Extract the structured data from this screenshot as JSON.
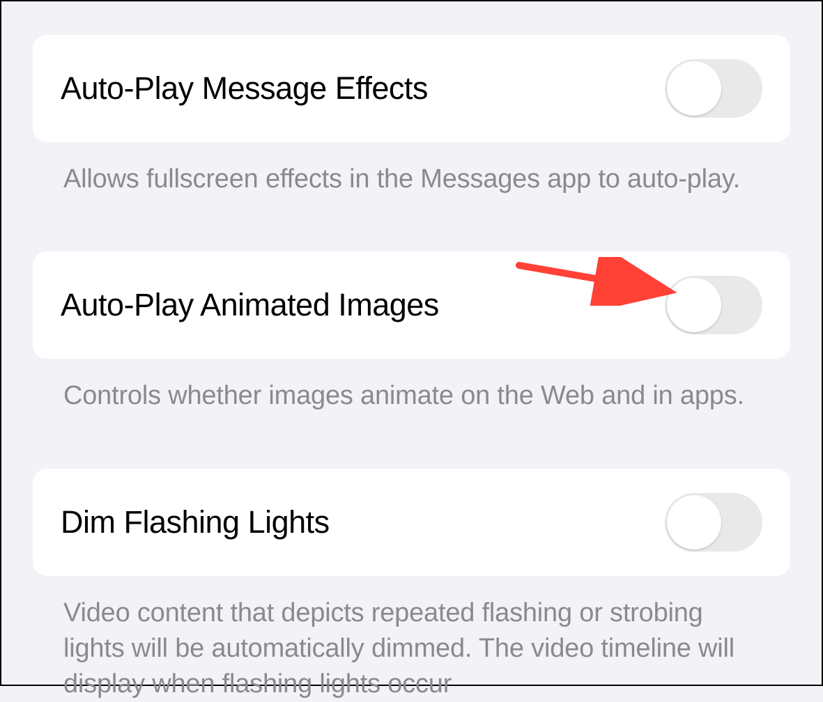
{
  "settings": [
    {
      "label": "Auto-Play Message Effects",
      "description": "Allows fullscreen effects in the Messages app to auto-play.",
      "enabled": false
    },
    {
      "label": "Auto-Play Animated Images",
      "description": "Controls whether images animate on the Web and in apps.",
      "enabled": false
    },
    {
      "label": "Dim Flashing Lights",
      "description": "Video content that depicts repeated flashing or strobing lights will be automatically dimmed. The video timeline will display when flashing lights occur",
      "enabled": false
    }
  ],
  "annotation": {
    "color": "#ff4136"
  }
}
